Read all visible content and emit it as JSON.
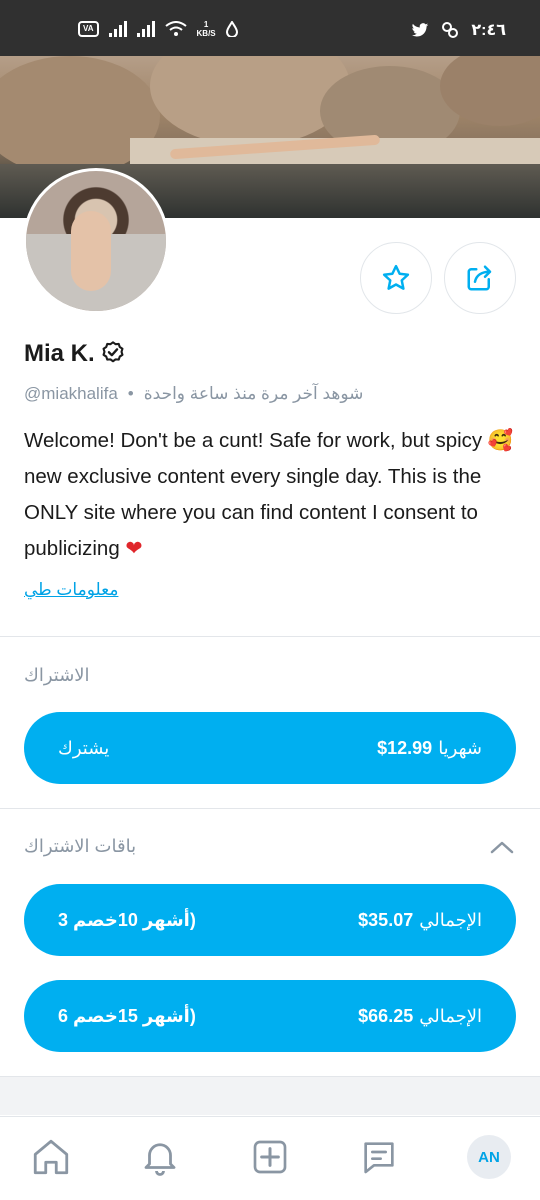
{
  "status_bar": {
    "vo_badge": "VA",
    "speed_value": "1",
    "speed_unit": "KB/S",
    "clock": "٢:٤٦"
  },
  "profile": {
    "name": "Mia K.",
    "handle": "@miakhalifa",
    "separator": "•",
    "last_seen": "شوهد آخر مرة منذ ساعة واحدة",
    "bio_part1": "Welcome! Don't be a cunt! Safe for work, but spicy ",
    "bio_emoji": "🥰",
    "bio_part2": " new exclusive content every single day. This is the ONLY site where you can find content I consent to publicizing ",
    "bio_heart": "❤",
    "info_link": "معلومات طي"
  },
  "subscription": {
    "title": "الاشتراك",
    "monthly_label": "شهريا",
    "monthly_price": "$12.99",
    "subscribe_label": "يشترك"
  },
  "bundles": {
    "title": "باقات الاشتراك",
    "items": [
      {
        "total_label": "الإجمالي",
        "price": "$35.07",
        "detail": "(أشهر 10خصم 3"
      },
      {
        "total_label": "الإجمالي",
        "price": "$66.25",
        "detail": "(أشهر 15خصم 6"
      }
    ]
  },
  "bottom_nav": {
    "avatar_initials": "AN"
  },
  "colors": {
    "accent": "#00aff0",
    "status_bar": "#303030",
    "muted_text": "#8a96a3"
  },
  "icons": [
    "favorite-star-icon",
    "share-icon",
    "verified-badge-icon",
    "chevron-up-icon",
    "home-icon",
    "bell-icon",
    "add-post-icon",
    "messages-icon",
    "wifi-icon",
    "twitter-icon"
  ]
}
